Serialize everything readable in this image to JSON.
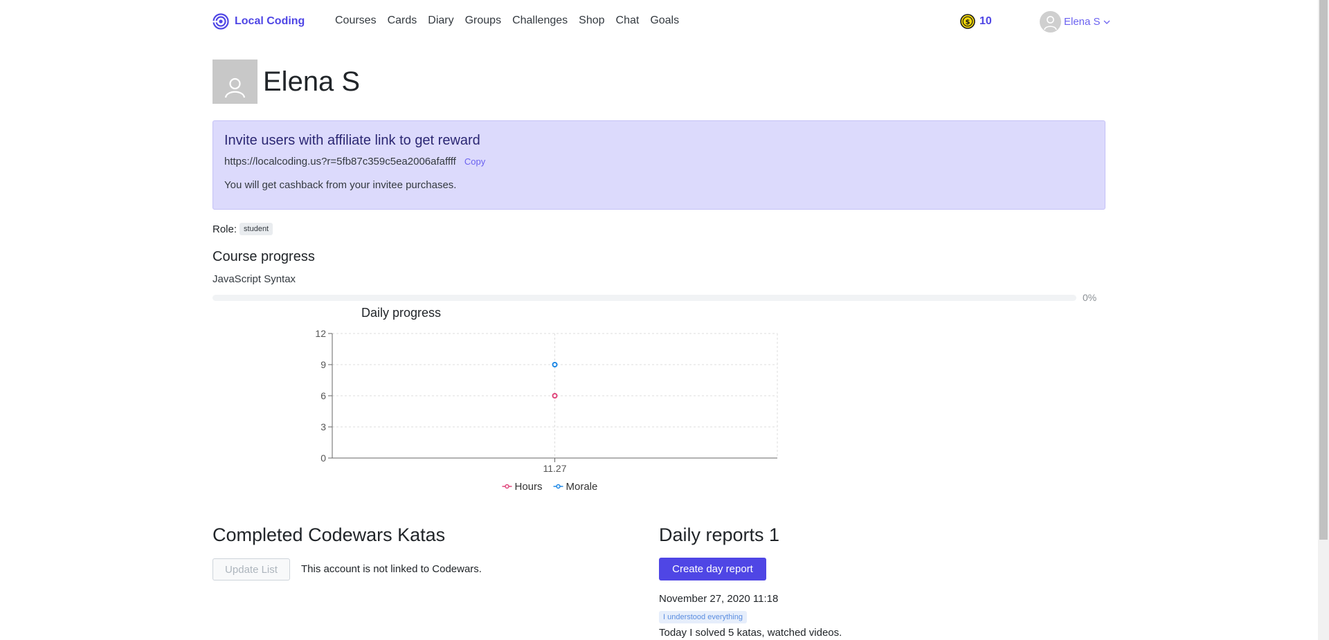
{
  "navbar": {
    "brand": "Local Coding",
    "links": [
      "Courses",
      "Cards",
      "Diary",
      "Groups",
      "Challenges",
      "Shop",
      "Chat",
      "Goals"
    ],
    "coins": "10",
    "user_name": "Elena S"
  },
  "profile": {
    "name": "Elena S"
  },
  "affiliate": {
    "title": "Invite users with affiliate link to get reward",
    "link": "https://localcoding.us?r=5fb87c359c5ea2006afaffff",
    "copy_label": "Copy",
    "note": "You will get cashback from your invitee purchases."
  },
  "role": {
    "label": "Role:",
    "value": "student"
  },
  "course_progress": {
    "title": "Course progress",
    "course_name": "JavaScript Syntax",
    "percent_label": "0%",
    "percent": 0
  },
  "chart_data": {
    "type": "line",
    "title": "Daily progress",
    "categories": [
      "11.27"
    ],
    "series": [
      {
        "name": "Hours",
        "values": [
          6
        ],
        "color": "#e0457b"
      },
      {
        "name": "Morale",
        "values": [
          9
        ],
        "color": "#1e88e5"
      }
    ],
    "ylim": [
      0,
      12
    ],
    "yticks": [
      0,
      3,
      6,
      9,
      12
    ],
    "grid": true,
    "legend": "bottom"
  },
  "codewars": {
    "title": "Completed Codewars Katas",
    "update_label": "Update List",
    "note": "This account is not linked to Codewars."
  },
  "reports": {
    "title": "Daily reports 1",
    "create_label": "Create day report",
    "items": [
      {
        "date": "November 27, 2020 11:18",
        "tag": "I understood everything",
        "text": "Today I solved 5 katas, watched videos."
      }
    ]
  },
  "colors": {
    "accent": "#4f46e5",
    "affiliate_bg": "#dcdafc"
  },
  "icons": {
    "brand": "target-logo-icon",
    "coin": "coin-icon",
    "avatar": "user-avatar-icon",
    "chevron": "chevron-down-icon"
  }
}
